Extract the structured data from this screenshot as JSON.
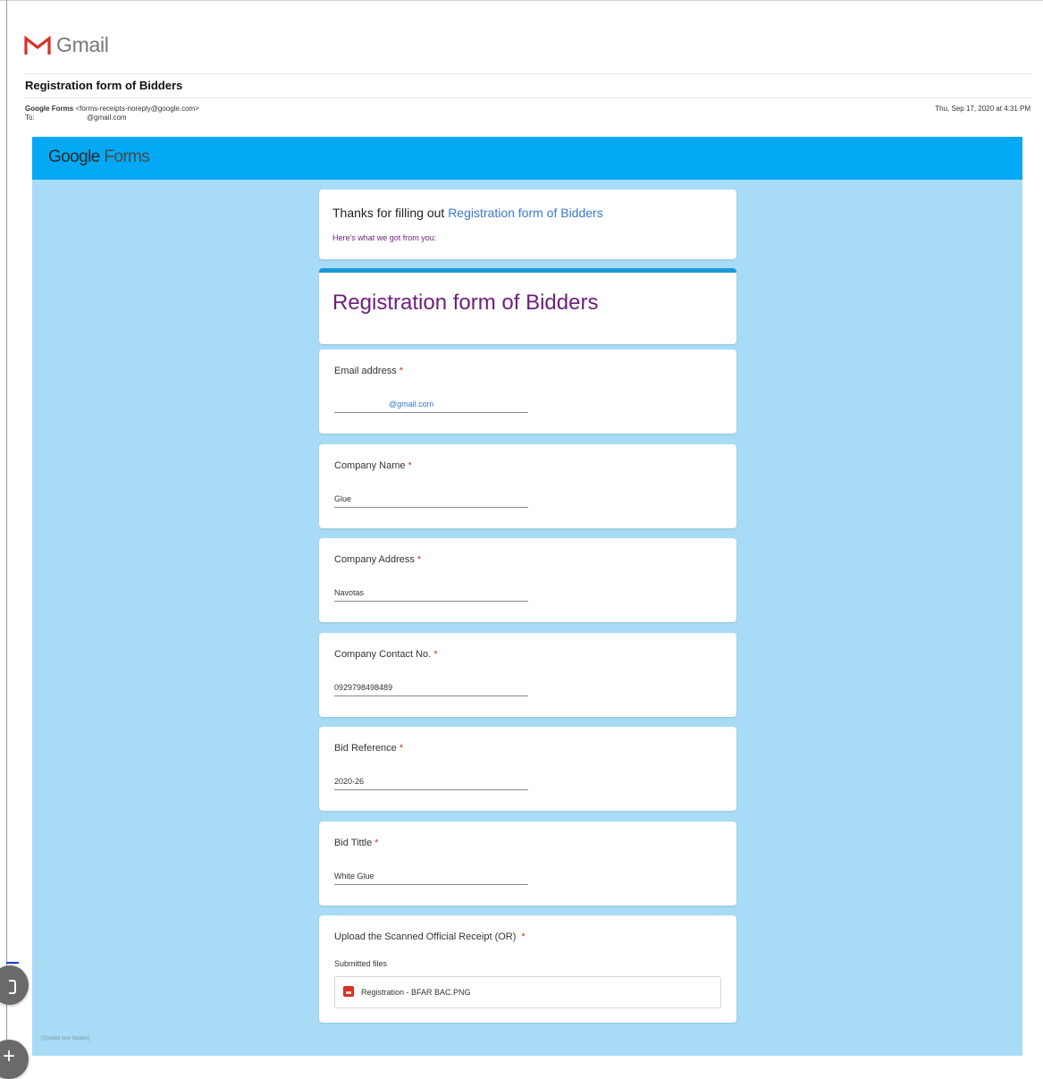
{
  "gmail": {
    "logo_text": "Gmail",
    "icon": "gmail-m-icon"
  },
  "email": {
    "subject": "Registration form of Bidders",
    "from_name": "Google Forms",
    "from_address": "<forms-receipts-noreply@google.com>",
    "to_label": "To:",
    "to_address": "@gmail.com",
    "date": "Thu, Sep 17, 2020 at 4:31 PM"
  },
  "forms": {
    "logo_google": "Google",
    "logo_forms": "Forms",
    "header_color": "#03a9f4",
    "canvas_color": "#a8dcf6"
  },
  "receipt": {
    "thanks_prefix": "Thanks for filling out",
    "thanks_link": "Registration form of Bidders",
    "got_text": "Here's what we got from you:",
    "form_title": "Registration form of Bidders"
  },
  "questions": [
    {
      "label": "Email address",
      "required": "*",
      "value": "@gmail.com"
    },
    {
      "label": "Company Name",
      "required": "*",
      "value": "Glue"
    },
    {
      "label": "Company Address",
      "required": "*",
      "value": "Navotas"
    },
    {
      "label": "Company Contact No.",
      "required": "*",
      "value": "09297984984​89"
    },
    {
      "label": "Bid Reference",
      "required": "*",
      "value": "2020-26"
    },
    {
      "label": "Bid Tittle",
      "required": "*",
      "value": "White Glue"
    }
  ],
  "upload": {
    "label": "Upload the Scanned Official Receipt (OR)",
    "required": "*",
    "submitted_label": "Submitted files",
    "file_name": "Registration - BFAR BAC.PNG",
    "file_icon": "image-file-icon"
  },
  "footer": {
    "quoted": "[Quoted text hidden]"
  }
}
